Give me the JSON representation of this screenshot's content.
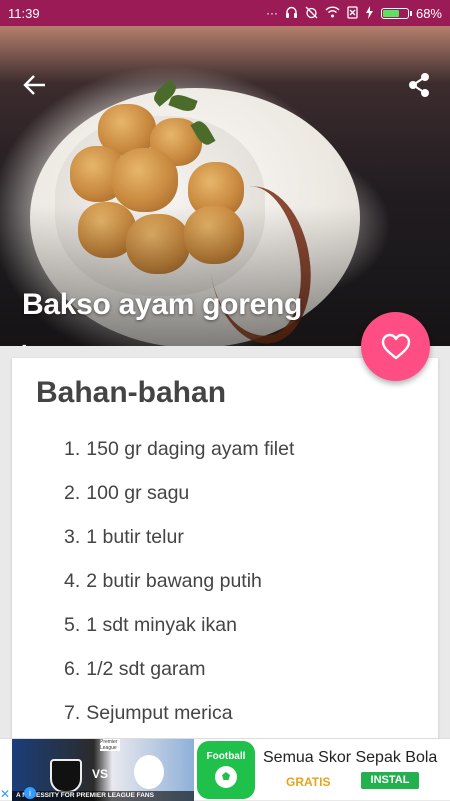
{
  "status_bar": {
    "time": "11:39",
    "icons": [
      "dots-icon",
      "headset-icon",
      "alarm-off-icon",
      "wifi-icon",
      "sim-off-icon",
      "charging-icon"
    ],
    "battery_percent": "68%",
    "battery_level": 0.68,
    "background": "#9b1b56"
  },
  "header": {
    "back_icon": "arrow-left-icon",
    "share_icon": "share-icon",
    "title": "Bakso ayam goreng",
    "subtitle": "-"
  },
  "favorite": {
    "icon": "heart-outline-icon",
    "color": "#ff4e84"
  },
  "ingredients": {
    "heading": "Bahan-bahan",
    "items": [
      {
        "num": "1.",
        "text": "150 gr daging ayam filet"
      },
      {
        "num": "2.",
        "text": "100 gr sagu"
      },
      {
        "num": "3.",
        "text": "1 butir telur"
      },
      {
        "num": "4.",
        "text": "2 butir bawang putih"
      },
      {
        "num": "5.",
        "text": "1 sdt minyak ikan"
      },
      {
        "num": "6.",
        "text": "1/2 sdt garam"
      },
      {
        "num": "7.",
        "text": "Sejumput merica"
      }
    ]
  },
  "ad": {
    "image_tagline": "A NECESSITY FOR PREMIER LEAGUE FANS",
    "image_vs": "VS",
    "image_league": "Premier League",
    "logo_label": "Football",
    "title": "Semua Skor Sepak Bola",
    "free_label": "GRATIS",
    "install_label": "INSTAL",
    "close_icon": "close-icon",
    "info_icon": "info-icon"
  }
}
